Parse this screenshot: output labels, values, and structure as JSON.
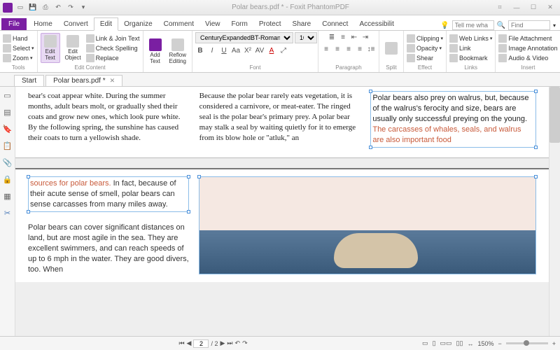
{
  "title": "Polar bears.pdf * - Foxit PhantomPDF",
  "qat": [
    "open",
    "save",
    "print",
    "undo",
    "redo"
  ],
  "menus": [
    "File",
    "Home",
    "Convert",
    "Edit",
    "Organize",
    "Comment",
    "View",
    "Form",
    "Protect",
    "Share",
    "Connect",
    "Accessibilit"
  ],
  "active_menu": "Edit",
  "tellme_placeholder": "Tell me wha",
  "find_placeholder": "Find",
  "ribbon": {
    "tools": {
      "label": "Tools",
      "hand": "Hand",
      "select": "Select",
      "zoom": "Zoom"
    },
    "editcontent": {
      "label": "Edit Content",
      "edit_text": "Edit\nText",
      "edit_object": "Edit\nObject",
      "link_join": "Link & Join Text",
      "check_spell": "Check Spelling",
      "replace": "Replace"
    },
    "reflow": {
      "label": "",
      "btn": "Add\nText",
      "reflow": "Reflow\nEditing"
    },
    "font": {
      "label": "Font",
      "family": "CenturyExpandedBT-Roman",
      "size": "10"
    },
    "paragraph": {
      "label": "Paragraph"
    },
    "split": {
      "label": "Split"
    },
    "effect": {
      "label": "Effect",
      "clipping": "Clipping",
      "opacity": "Opacity",
      "shear": "Shear"
    },
    "links": {
      "label": "Links",
      "web": "Web Links",
      "link": "Link",
      "bookmark": "Bookmark"
    },
    "insert": {
      "label": "Insert",
      "file": "File Attachment",
      "image": "Image Annotation",
      "audio": "Audio & Video"
    }
  },
  "end_icons": [
    "gear",
    "bell",
    "share",
    "help"
  ],
  "doctabs": [
    {
      "label": "Start",
      "closable": false
    },
    {
      "label": "Polar bears.pdf *",
      "closable": true
    }
  ],
  "left_icons": [
    "page",
    "copy",
    "book",
    "clip",
    "link",
    "lock",
    "list",
    "cut"
  ],
  "doc": {
    "col1": "bear's coat appear white. During the summer months, adult bears molt, or gradually shed their coats and grow new ones, which look pure white. By the following spring, the sunshine has caused their coats to turn a yellowish shade.",
    "col2_indent": "   Because the polar bear rarely eats vegetation, it is considered a carnivore, or meat-eater. The ringed seal is the polar bear's primary prey. A polar bear may stalk a seal by waiting quietly for it to emerge from its blow hole or \"atluk,\" an",
    "col3_a": "Polar bears also prey on walrus, but, because of the walrus's ferocity and size, bears are usually only successful preying on the young. ",
    "col3_b": "The carcasses of whales, seals, and walrus are also important food",
    "p2_a": "sources for polar bears.",
    "p2_b": " In fact, because of their acute sense of smell, polar bears can sense carcasses from many miles away.",
    "p2_c": "Polar bears can cover significant distances on land, but are most agile in the sea. They are excellent swimmers, and can reach speeds of up to 6 mph in the water. They are good divers, too. When"
  },
  "status": {
    "page_current": "2",
    "page_total": "/ 2",
    "zoom": "150%"
  }
}
